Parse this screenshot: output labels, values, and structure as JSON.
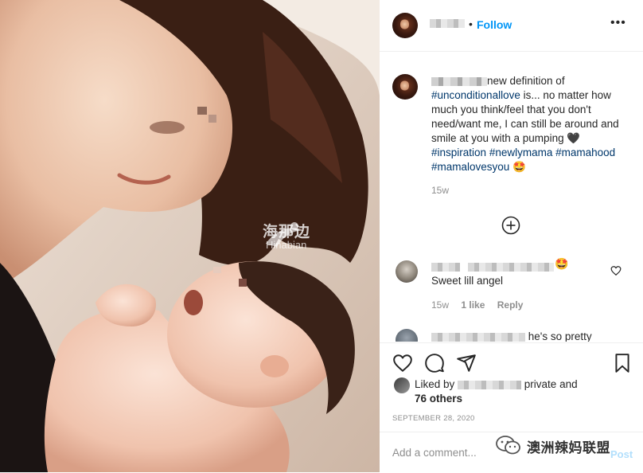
{
  "header": {
    "follow_label": "Follow",
    "separator": "•",
    "more_icon": "more-horizontal-icon"
  },
  "caption": {
    "text_start": "new definition of ",
    "tag1": "#unconditionallove",
    "text_mid": " is... no matter how much you think/feel that you don't need/want me, I can still be around and smile at you with a pumping ",
    "heart": "🖤",
    "tag2": "#inspiration",
    "tag3": "#newlymama",
    "tag4": "#mamahood",
    "tag5": "#mamalovesyou",
    "emoji": "🤩",
    "time": "15w"
  },
  "comments": [
    {
      "emoji": "🤩",
      "text": "Sweet lill angel",
      "time": "15w",
      "likes": "1 like",
      "reply_label": "Reply"
    },
    {
      "text": "he's so pretty"
    }
  ],
  "actions": {
    "liked_prefix": "Liked by ",
    "liked_mid": " private and",
    "others": "76 others",
    "date": "SEPTEMBER 28, 2020",
    "icons": [
      "heart-icon",
      "comment-icon",
      "share-icon",
      "bookmark-icon"
    ]
  },
  "add_comment": {
    "placeholder": "Add a comment...",
    "post_label": "Post"
  },
  "watermark": {
    "cn": "海那边",
    "en": "Hinabian"
  },
  "badge": {
    "text": "澳洲辣妈联盟"
  },
  "colors": {
    "link": "#0095f6",
    "tag": "#00376b",
    "muted": "#8e8e8e"
  }
}
